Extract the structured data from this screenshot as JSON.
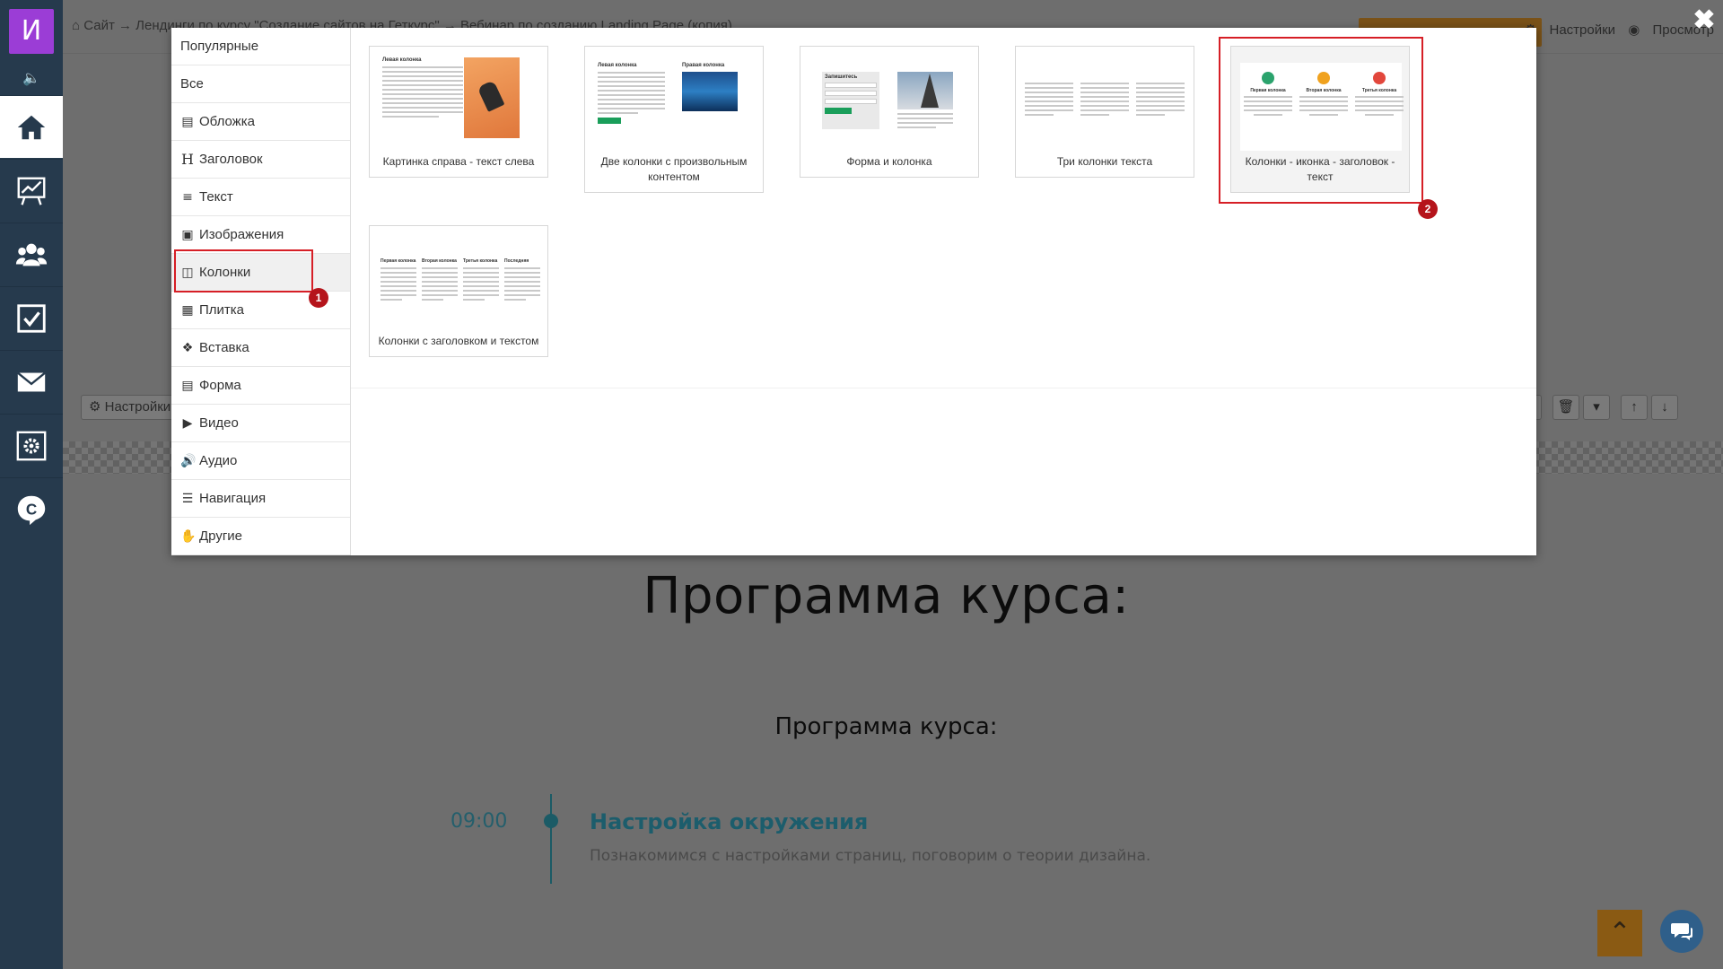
{
  "app": {
    "logo_letter": "И"
  },
  "topbar": {
    "breadcrumb": "Сайт → Лендинги по курсу \"Создание сайтов на Геткурс\" → Вебинар по созданию Landing Page (копия)",
    "settings_label": "Настройки",
    "preview_label": "Просмотр"
  },
  "background_page": {
    "settings_button": "Настройки",
    "course_title": "Программа курса:",
    "course_subtitle": "Программа курса:",
    "timeline_time": "09:00",
    "timeline_title": "Настройка окружения",
    "timeline_desc": "Познакомимся с настройками страниц, поговорим о теории дизайна."
  },
  "modal": {
    "categories": [
      {
        "label": "Популярные",
        "icon": ""
      },
      {
        "label": "Все",
        "icon": ""
      },
      {
        "label": "Обложка",
        "icon": "camera-icon"
      },
      {
        "label": "Заголовок",
        "icon": "header-icon"
      },
      {
        "label": "Текст",
        "icon": "align-justify-icon"
      },
      {
        "label": "Изображения",
        "icon": "image-icon"
      },
      {
        "label": "Колонки",
        "icon": "columns-icon"
      },
      {
        "label": "Плитка",
        "icon": "th-large-icon"
      },
      {
        "label": "Вставка",
        "icon": "cubes-icon"
      },
      {
        "label": "Форма",
        "icon": "form-icon"
      },
      {
        "label": "Видео",
        "icon": "youtube-icon"
      },
      {
        "label": "Аудио",
        "icon": "volume-icon"
      },
      {
        "label": "Навигация",
        "icon": "bars-icon"
      },
      {
        "label": "Другие",
        "icon": "hand-icon"
      }
    ],
    "selected_category": "Колонки",
    "templates": [
      {
        "caption": "Картинка справа - текст слева"
      },
      {
        "caption": "Две колонки с произвольным контентом"
      },
      {
        "caption": "Форма и колонка"
      },
      {
        "caption": "Три колонки текста"
      },
      {
        "caption": "Колонки - иконка - заголовок - текст"
      },
      {
        "caption": "Колонки с заголовком и текстом"
      }
    ],
    "thumb_texts": {
      "left_column": "Левая колонка",
      "right_column": "Правая колонка",
      "subscribe": "Запишитесь",
      "first_column": "Первая колонка",
      "second_column": "Вторая колонка",
      "third_column": "Третья колонка",
      "last_column": "Последняя"
    },
    "badges": [
      "1",
      "2"
    ]
  },
  "colors": {
    "sidebar_bg": "#263a4d",
    "logo_bg": "#9b3dd6",
    "highlight": "#d61f26",
    "badge": "#b5141b",
    "teal": "#1b5b66",
    "orange": "#8a5a13"
  }
}
